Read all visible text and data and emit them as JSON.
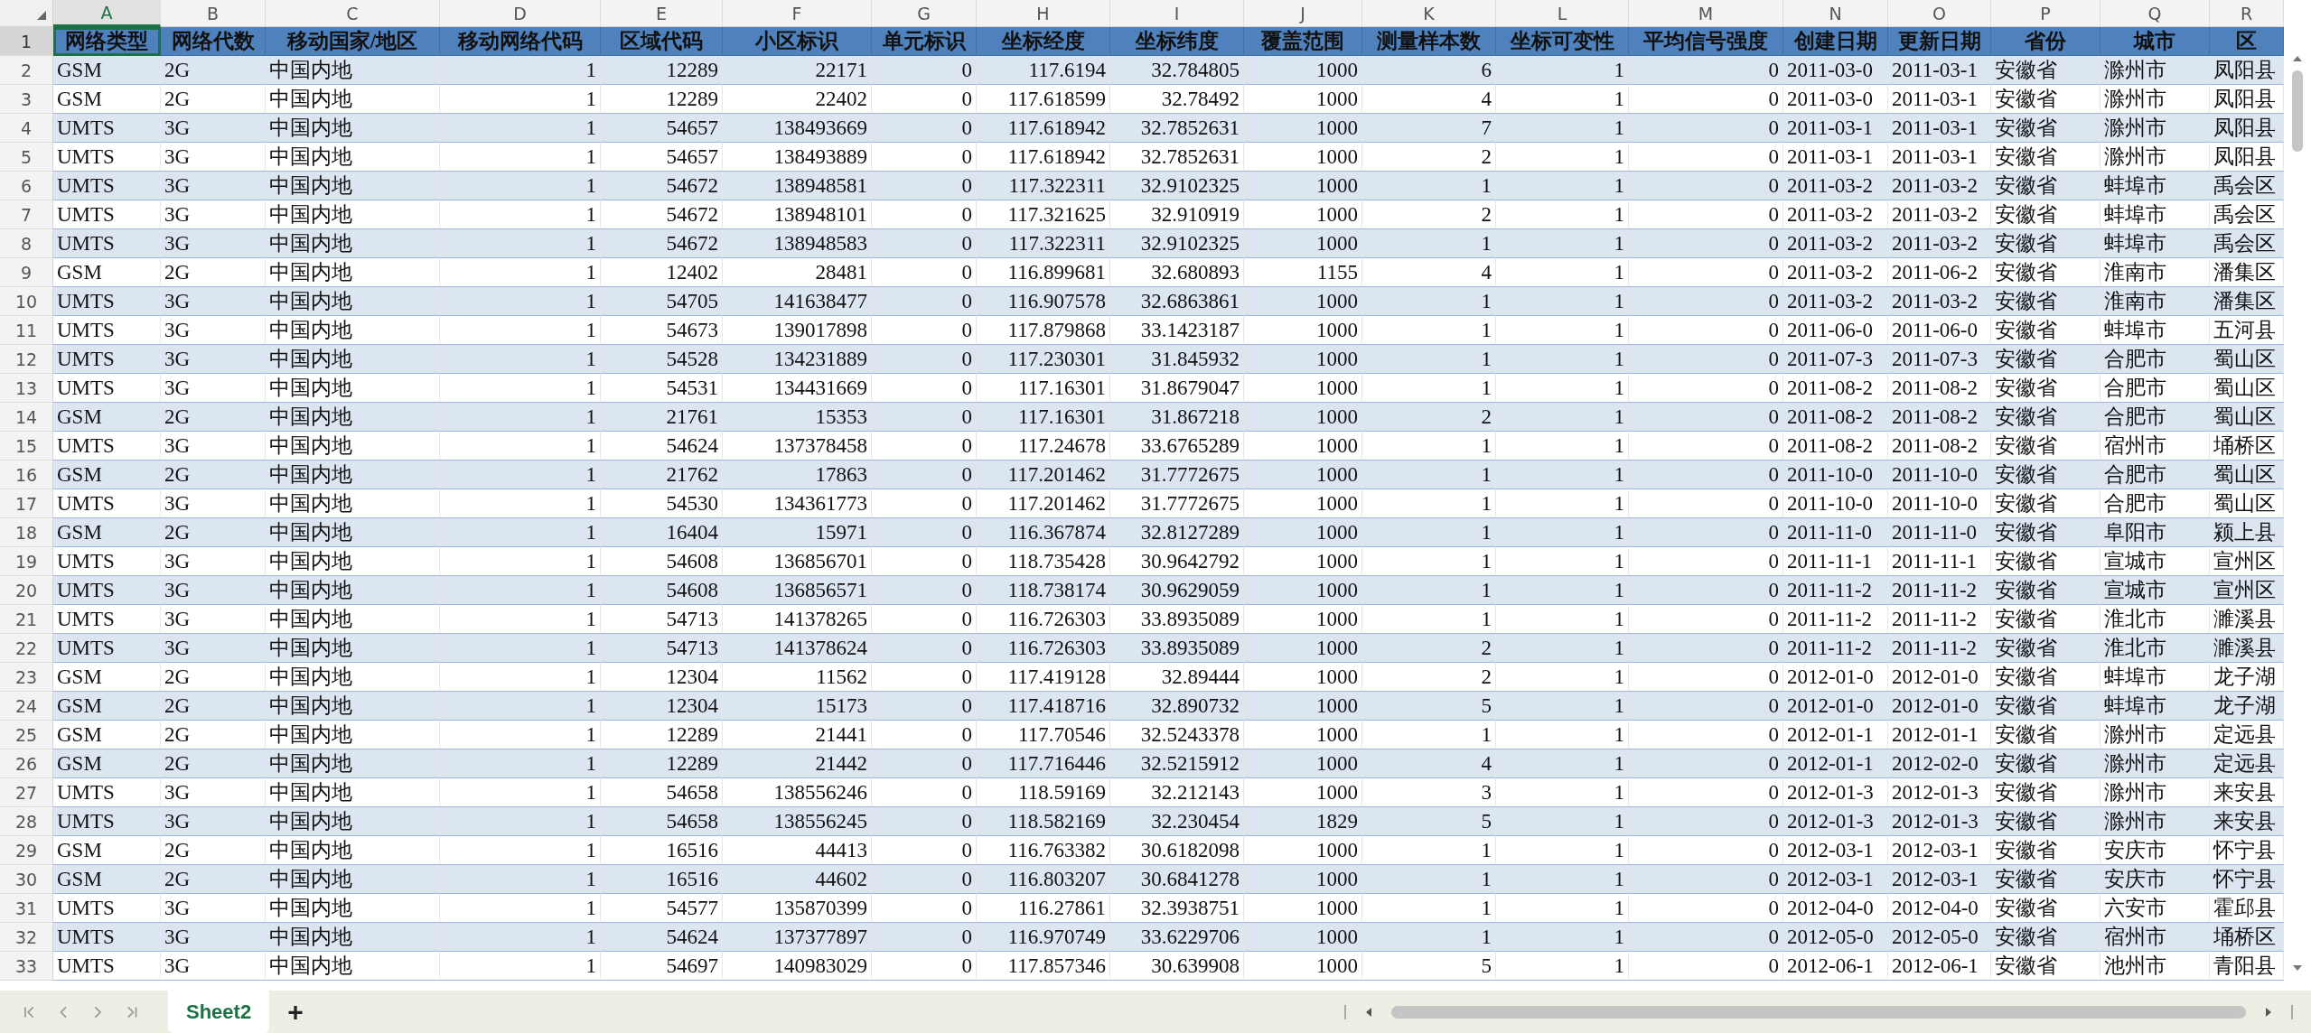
{
  "columns": [
    {
      "letter": "A",
      "kind": "text",
      "selected": true
    },
    {
      "letter": "B",
      "kind": "text",
      "selected": false
    },
    {
      "letter": "C",
      "kind": "text",
      "selected": false
    },
    {
      "letter": "D",
      "kind": "number",
      "selected": false
    },
    {
      "letter": "E",
      "kind": "number",
      "selected": false
    },
    {
      "letter": "F",
      "kind": "number",
      "selected": false
    },
    {
      "letter": "G",
      "kind": "number",
      "selected": false
    },
    {
      "letter": "H",
      "kind": "number",
      "selected": false
    },
    {
      "letter": "I",
      "kind": "number",
      "selected": false
    },
    {
      "letter": "J",
      "kind": "number",
      "selected": false
    },
    {
      "letter": "K",
      "kind": "number",
      "selected": false
    },
    {
      "letter": "L",
      "kind": "number",
      "selected": false
    },
    {
      "letter": "M",
      "kind": "number",
      "selected": false
    },
    {
      "letter": "N",
      "kind": "text",
      "selected": false
    },
    {
      "letter": "O",
      "kind": "text",
      "selected": false
    },
    {
      "letter": "P",
      "kind": "text",
      "selected": false
    },
    {
      "letter": "Q",
      "kind": "text",
      "selected": false
    },
    {
      "letter": "R",
      "kind": "text",
      "selected": false
    }
  ],
  "header_row": {
    "num": "1",
    "selected": true,
    "cells": [
      "网络类型",
      "网络代数",
      "移动国家/地区",
      "移动网络代码",
      "区域代码",
      "小区标识",
      "单元标识",
      "坐标经度",
      "坐标纬度",
      "覆盖范围",
      "测量样本数",
      "坐标可变性",
      "平均信号强度",
      "创建日期",
      "更新日期",
      "省份",
      "城市",
      "区"
    ]
  },
  "rows": [
    {
      "num": "2",
      "selected": false,
      "cells": [
        "GSM",
        "2G",
        "中国内地",
        "1",
        "12289",
        "22171",
        "0",
        "117.6194",
        "32.784805",
        "1000",
        "6",
        "1",
        "0",
        "2011-03-0",
        "2011-03-1",
        "安徽省",
        "滁州市",
        "凤阳县"
      ]
    },
    {
      "num": "3",
      "selected": false,
      "cells": [
        "GSM",
        "2G",
        "中国内地",
        "1",
        "12289",
        "22402",
        "0",
        "117.618599",
        "32.78492",
        "1000",
        "4",
        "1",
        "0",
        "2011-03-0",
        "2011-03-1",
        "安徽省",
        "滁州市",
        "凤阳县"
      ]
    },
    {
      "num": "4",
      "selected": false,
      "cells": [
        "UMTS",
        "3G",
        "中国内地",
        "1",
        "54657",
        "138493669",
        "0",
        "117.618942",
        "32.7852631",
        "1000",
        "7",
        "1",
        "0",
        "2011-03-1",
        "2011-03-1",
        "安徽省",
        "滁州市",
        "凤阳县"
      ]
    },
    {
      "num": "5",
      "selected": false,
      "cells": [
        "UMTS",
        "3G",
        "中国内地",
        "1",
        "54657",
        "138493889",
        "0",
        "117.618942",
        "32.7852631",
        "1000",
        "2",
        "1",
        "0",
        "2011-03-1",
        "2011-03-1",
        "安徽省",
        "滁州市",
        "凤阳县"
      ]
    },
    {
      "num": "6",
      "selected": false,
      "cells": [
        "UMTS",
        "3G",
        "中国内地",
        "1",
        "54672",
        "138948581",
        "0",
        "117.322311",
        "32.9102325",
        "1000",
        "1",
        "1",
        "0",
        "2011-03-2",
        "2011-03-2",
        "安徽省",
        "蚌埠市",
        "禹会区"
      ]
    },
    {
      "num": "7",
      "selected": false,
      "cells": [
        "UMTS",
        "3G",
        "中国内地",
        "1",
        "54672",
        "138948101",
        "0",
        "117.321625",
        "32.910919",
        "1000",
        "2",
        "1",
        "0",
        "2011-03-2",
        "2011-03-2",
        "安徽省",
        "蚌埠市",
        "禹会区"
      ]
    },
    {
      "num": "8",
      "selected": false,
      "cells": [
        "UMTS",
        "3G",
        "中国内地",
        "1",
        "54672",
        "138948583",
        "0",
        "117.322311",
        "32.9102325",
        "1000",
        "1",
        "1",
        "0",
        "2011-03-2",
        "2011-03-2",
        "安徽省",
        "蚌埠市",
        "禹会区"
      ]
    },
    {
      "num": "9",
      "selected": false,
      "cells": [
        "GSM",
        "2G",
        "中国内地",
        "1",
        "12402",
        "28481",
        "0",
        "116.899681",
        "32.680893",
        "1155",
        "4",
        "1",
        "0",
        "2011-03-2",
        "2011-06-2",
        "安徽省",
        "淮南市",
        "潘集区"
      ]
    },
    {
      "num": "10",
      "selected": false,
      "cells": [
        "UMTS",
        "3G",
        "中国内地",
        "1",
        "54705",
        "141638477",
        "0",
        "116.907578",
        "32.6863861",
        "1000",
        "1",
        "1",
        "0",
        "2011-03-2",
        "2011-03-2",
        "安徽省",
        "淮南市",
        "潘集区"
      ]
    },
    {
      "num": "11",
      "selected": false,
      "cells": [
        "UMTS",
        "3G",
        "中国内地",
        "1",
        "54673",
        "139017898",
        "0",
        "117.879868",
        "33.1423187",
        "1000",
        "1",
        "1",
        "0",
        "2011-06-0",
        "2011-06-0",
        "安徽省",
        "蚌埠市",
        "五河县"
      ]
    },
    {
      "num": "12",
      "selected": false,
      "cells": [
        "UMTS",
        "3G",
        "中国内地",
        "1",
        "54528",
        "134231889",
        "0",
        "117.230301",
        "31.845932",
        "1000",
        "1",
        "1",
        "0",
        "2011-07-3",
        "2011-07-3",
        "安徽省",
        "合肥市",
        "蜀山区"
      ]
    },
    {
      "num": "13",
      "selected": false,
      "cells": [
        "UMTS",
        "3G",
        "中国内地",
        "1",
        "54531",
        "134431669",
        "0",
        "117.16301",
        "31.8679047",
        "1000",
        "1",
        "1",
        "0",
        "2011-08-2",
        "2011-08-2",
        "安徽省",
        "合肥市",
        "蜀山区"
      ]
    },
    {
      "num": "14",
      "selected": false,
      "cells": [
        "GSM",
        "2G",
        "中国内地",
        "1",
        "21761",
        "15353",
        "0",
        "117.16301",
        "31.867218",
        "1000",
        "2",
        "1",
        "0",
        "2011-08-2",
        "2011-08-2",
        "安徽省",
        "合肥市",
        "蜀山区"
      ]
    },
    {
      "num": "15",
      "selected": false,
      "cells": [
        "UMTS",
        "3G",
        "中国内地",
        "1",
        "54624",
        "137378458",
        "0",
        "117.24678",
        "33.6765289",
        "1000",
        "1",
        "1",
        "0",
        "2011-08-2",
        "2011-08-2",
        "安徽省",
        "宿州市",
        "埇桥区"
      ]
    },
    {
      "num": "16",
      "selected": false,
      "cells": [
        "GSM",
        "2G",
        "中国内地",
        "1",
        "21762",
        "17863",
        "0",
        "117.201462",
        "31.7772675",
        "1000",
        "1",
        "1",
        "0",
        "2011-10-0",
        "2011-10-0",
        "安徽省",
        "合肥市",
        "蜀山区"
      ]
    },
    {
      "num": "17",
      "selected": false,
      "cells": [
        "UMTS",
        "3G",
        "中国内地",
        "1",
        "54530",
        "134361773",
        "0",
        "117.201462",
        "31.7772675",
        "1000",
        "1",
        "1",
        "0",
        "2011-10-0",
        "2011-10-0",
        "安徽省",
        "合肥市",
        "蜀山区"
      ]
    },
    {
      "num": "18",
      "selected": false,
      "cells": [
        "GSM",
        "2G",
        "中国内地",
        "1",
        "16404",
        "15971",
        "0",
        "116.367874",
        "32.8127289",
        "1000",
        "1",
        "1",
        "0",
        "2011-11-0",
        "2011-11-0",
        "安徽省",
        "阜阳市",
        "颍上县"
      ]
    },
    {
      "num": "19",
      "selected": false,
      "cells": [
        "UMTS",
        "3G",
        "中国内地",
        "1",
        "54608",
        "136856701",
        "0",
        "118.735428",
        "30.9642792",
        "1000",
        "1",
        "1",
        "0",
        "2011-11-1",
        "2011-11-1",
        "安徽省",
        "宣城市",
        "宣州区"
      ]
    },
    {
      "num": "20",
      "selected": false,
      "cells": [
        "UMTS",
        "3G",
        "中国内地",
        "1",
        "54608",
        "136856571",
        "0",
        "118.738174",
        "30.9629059",
        "1000",
        "1",
        "1",
        "0",
        "2011-11-2",
        "2011-11-2",
        "安徽省",
        "宣城市",
        "宣州区"
      ]
    },
    {
      "num": "21",
      "selected": false,
      "cells": [
        "UMTS",
        "3G",
        "中国内地",
        "1",
        "54713",
        "141378265",
        "0",
        "116.726303",
        "33.8935089",
        "1000",
        "1",
        "1",
        "0",
        "2011-11-2",
        "2011-11-2",
        "安徽省",
        "淮北市",
        "濉溪县"
      ]
    },
    {
      "num": "22",
      "selected": false,
      "cells": [
        "UMTS",
        "3G",
        "中国内地",
        "1",
        "54713",
        "141378624",
        "0",
        "116.726303",
        "33.8935089",
        "1000",
        "2",
        "1",
        "0",
        "2011-11-2",
        "2011-11-2",
        "安徽省",
        "淮北市",
        "濉溪县"
      ]
    },
    {
      "num": "23",
      "selected": false,
      "cells": [
        "GSM",
        "2G",
        "中国内地",
        "1",
        "12304",
        "11562",
        "0",
        "117.419128",
        "32.89444",
        "1000",
        "2",
        "1",
        "0",
        "2012-01-0",
        "2012-01-0",
        "安徽省",
        "蚌埠市",
        "龙子湖"
      ]
    },
    {
      "num": "24",
      "selected": false,
      "cells": [
        "GSM",
        "2G",
        "中国内地",
        "1",
        "12304",
        "15173",
        "0",
        "117.418716",
        "32.890732",
        "1000",
        "5",
        "1",
        "0",
        "2012-01-0",
        "2012-01-0",
        "安徽省",
        "蚌埠市",
        "龙子湖"
      ]
    },
    {
      "num": "25",
      "selected": false,
      "cells": [
        "GSM",
        "2G",
        "中国内地",
        "1",
        "12289",
        "21441",
        "0",
        "117.70546",
        "32.5243378",
        "1000",
        "1",
        "1",
        "0",
        "2012-01-1",
        "2012-01-1",
        "安徽省",
        "滁州市",
        "定远县"
      ]
    },
    {
      "num": "26",
      "selected": false,
      "cells": [
        "GSM",
        "2G",
        "中国内地",
        "1",
        "12289",
        "21442",
        "0",
        "117.716446",
        "32.5215912",
        "1000",
        "4",
        "1",
        "0",
        "2012-01-1",
        "2012-02-0",
        "安徽省",
        "滁州市",
        "定远县"
      ]
    },
    {
      "num": "27",
      "selected": false,
      "cells": [
        "UMTS",
        "3G",
        "中国内地",
        "1",
        "54658",
        "138556246",
        "0",
        "118.59169",
        "32.212143",
        "1000",
        "3",
        "1",
        "0",
        "2012-01-3",
        "2012-01-3",
        "安徽省",
        "滁州市",
        "来安县"
      ]
    },
    {
      "num": "28",
      "selected": false,
      "cells": [
        "UMTS",
        "3G",
        "中国内地",
        "1",
        "54658",
        "138556245",
        "0",
        "118.582169",
        "32.230454",
        "1829",
        "5",
        "1",
        "0",
        "2012-01-3",
        "2012-01-3",
        "安徽省",
        "滁州市",
        "来安县"
      ]
    },
    {
      "num": "29",
      "selected": false,
      "cells": [
        "GSM",
        "2G",
        "中国内地",
        "1",
        "16516",
        "44413",
        "0",
        "116.763382",
        "30.6182098",
        "1000",
        "1",
        "1",
        "0",
        "2012-03-1",
        "2012-03-1",
        "安徽省",
        "安庆市",
        "怀宁县"
      ]
    },
    {
      "num": "30",
      "selected": false,
      "cells": [
        "GSM",
        "2G",
        "中国内地",
        "1",
        "16516",
        "44602",
        "0",
        "116.803207",
        "30.6841278",
        "1000",
        "1",
        "1",
        "0",
        "2012-03-1",
        "2012-03-1",
        "安徽省",
        "安庆市",
        "怀宁县"
      ]
    },
    {
      "num": "31",
      "selected": false,
      "cells": [
        "UMTS",
        "3G",
        "中国内地",
        "1",
        "54577",
        "135870399",
        "0",
        "116.27861",
        "32.3938751",
        "1000",
        "1",
        "1",
        "0",
        "2012-04-0",
        "2012-04-0",
        "安徽省",
        "六安市",
        "霍邱县"
      ]
    },
    {
      "num": "32",
      "selected": false,
      "cells": [
        "UMTS",
        "3G",
        "中国内地",
        "1",
        "54624",
        "137377897",
        "0",
        "116.970749",
        "33.6229706",
        "1000",
        "1",
        "1",
        "0",
        "2012-05-0",
        "2012-05-0",
        "安徽省",
        "宿州市",
        "埇桥区"
      ]
    },
    {
      "num": "33",
      "selected": false,
      "cells": [
        "UMTS",
        "3G",
        "中国内地",
        "1",
        "54697",
        "140983029",
        "0",
        "117.857346",
        "30.639908",
        "1000",
        "5",
        "1",
        "0",
        "2012-06-1",
        "2012-06-1",
        "安徽省",
        "池州市",
        "青阳县"
      ]
    }
  ],
  "sheet_tabs": [
    {
      "label": "Sheet2",
      "selected": true
    }
  ],
  "add_sheet": "+"
}
